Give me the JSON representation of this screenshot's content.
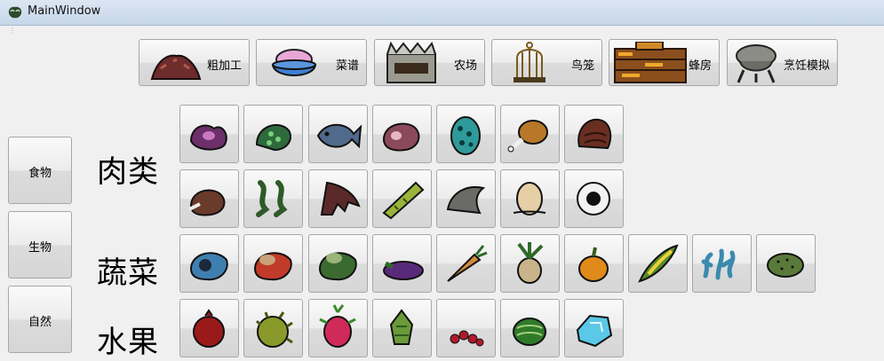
{
  "window": {
    "title": "MainWindow",
    "icon": "beefalo-app-icon"
  },
  "toolbar": {
    "buttons": [
      {
        "label": "粗加工",
        "icon": "raw-meat-pile-icon"
      },
      {
        "label": "菜谱",
        "icon": "ice-cream-bowl-icon"
      },
      {
        "label": "农场",
        "icon": "stone-farm-icon"
      },
      {
        "label": "鸟笼",
        "icon": "birdcage-icon"
      },
      {
        "label": "蜂房",
        "icon": "bee-box-icon"
      },
      {
        "label": "烹饪模拟",
        "icon": "crock-pot-icon"
      }
    ]
  },
  "sidebar": {
    "buttons": [
      {
        "label": "食物"
      },
      {
        "label": "生物"
      },
      {
        "label": "自然"
      }
    ]
  },
  "categories": [
    {
      "label": "肉类"
    },
    {
      "label": "蔬菜"
    },
    {
      "label": "水果"
    }
  ],
  "items": {
    "meat_row1": [
      "monster-meat-icon",
      "fish-morsel-icon",
      "fish-icon",
      "meat-icon",
      "tallbird-egg-icon",
      "drumstick-icon",
      "koalefant-trunk-icon"
    ],
    "meat_row2": [
      "cooked-meat-icon",
      "frog-legs-icon",
      "batilisk-wing-icon",
      "eel-icon",
      "hound-tooth-icon",
      "egg-icon",
      "deerclops-eyeball-icon"
    ],
    "vegetables": [
      "blue-cap-icon",
      "red-cap-icon",
      "green-cap-icon",
      "eggplant-icon",
      "carrot-icon",
      "mandrake-icon",
      "pumpkin-icon",
      "corn-icon",
      "lichen-icon",
      "cactus-flesh-icon"
    ],
    "fruits": [
      "pomegranate-icon",
      "durian-icon",
      "dragon-fruit-icon",
      "cactus-flower-icon",
      "berries-icon",
      "watermelon-icon",
      "ice-icon"
    ]
  }
}
